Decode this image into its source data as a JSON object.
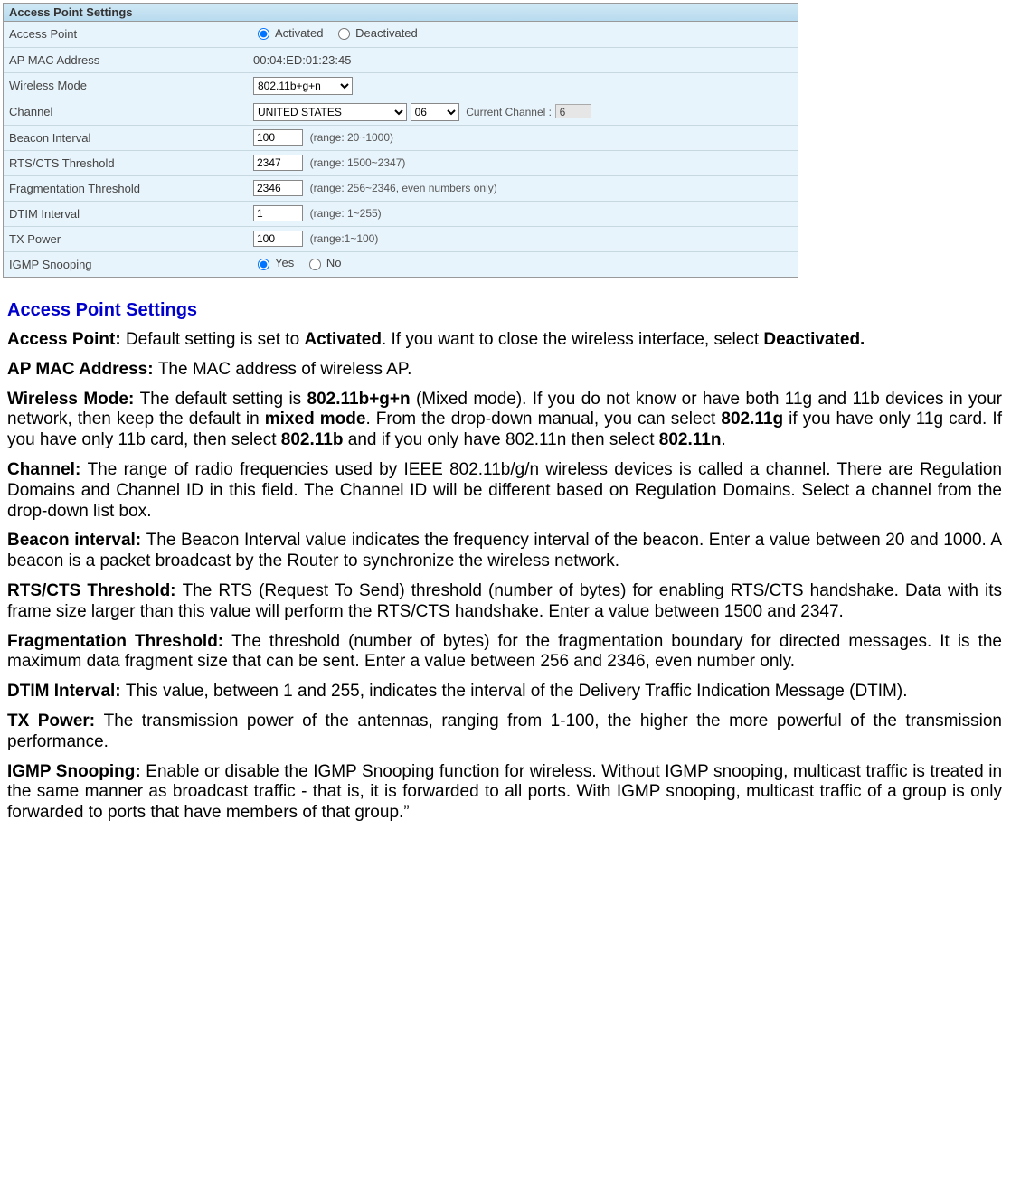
{
  "panel": {
    "title": "Access Point Settings",
    "rows": {
      "access_point": {
        "label": "Access Point",
        "opt_activated": "Activated",
        "opt_deactivated": "Deactivated"
      },
      "mac": {
        "label": "AP MAC Address",
        "value": "00:04:ED:01:23:45"
      },
      "wmode": {
        "label": "Wireless Mode",
        "value": "802.11b+g+n"
      },
      "channel": {
        "label": "Channel",
        "country": "UNITED STATES",
        "ch": "06",
        "current_label": "Current Channel :",
        "current_value": "6"
      },
      "beacon": {
        "label": "Beacon Interval",
        "value": "100",
        "hint": "(range: 20~1000)"
      },
      "rts": {
        "label": "RTS/CTS Threshold",
        "value": "2347",
        "hint": "(range: 1500~2347)"
      },
      "frag": {
        "label": "Fragmentation Threshold",
        "value": "2346",
        "hint": "(range: 256~2346, even numbers only)"
      },
      "dtim": {
        "label": "DTIM Interval",
        "value": "1",
        "hint": "(range: 1~255)"
      },
      "txpower": {
        "label": "TX Power",
        "value": "100",
        "hint": "(range:1~100)"
      },
      "igmp": {
        "label": "IGMP Snooping",
        "opt_yes": "Yes",
        "opt_no": "No"
      }
    }
  },
  "doc": {
    "heading": "Access Point Settings",
    "p_access_point_label": "Access Point: ",
    "p_access_point_1": "Default setting is set to ",
    "p_access_point_bold1": "Activated",
    "p_access_point_2": ". If you want to close the wireless interface, select ",
    "p_access_point_bold2": "Deactivated.",
    "p_mac_label": "AP MAC Address: ",
    "p_mac_text": "The MAC address of wireless AP.",
    "p_wmode_label": "Wireless Mode: ",
    "p_wmode_1": "The default setting is ",
    "p_wmode_bold1": "802.11b+g+n",
    "p_wmode_2": " (Mixed mode). If you do not know or have both 11g and 11b devices in your network, then keep the default in ",
    "p_wmode_bold2": "mixed mode",
    "p_wmode_3": ". From the drop-down manual, you can select ",
    "p_wmode_bold3": "802.11g",
    "p_wmode_4": " if you have only 11g card.  If you have only 11b card, then select ",
    "p_wmode_bold4": "802.11b",
    "p_wmode_5": " and if you only have 802.11n then select ",
    "p_wmode_bold5": "802.11n",
    "p_wmode_6": ".",
    "p_channel_label": "Channel: ",
    "p_channel_text": "The range of radio frequencies used by IEEE 802.11b/g/n wireless devices is called a channel. There are Regulation Domains and Channel ID in this field. The Channel ID will be different based on Regulation Domains. Select a channel from the drop-down list box.",
    "p_beacon_label": "Beacon interval: ",
    "p_beacon_text": "The Beacon Interval value indicates the frequency interval of the beacon. Enter a value between 20 and 1000. A beacon is a packet broadcast by the Router to synchronize the wireless network.",
    "p_rts_label": "RTS/CTS Threshold: ",
    "p_rts_text": "The RTS (Request To Send) threshold (number of bytes) for enabling RTS/CTS handshake. Data with its frame size larger than this value will perform the RTS/CTS handshake. Enter a value between 1500 and 2347.",
    "p_frag_label": "Fragmentation Threshold: ",
    "p_frag_text": "The threshold (number of bytes) for the fragmentation boundary for directed messages. It is the maximum data fragment size that can be sent. Enter a value between 256 and 2346, even number only.",
    "p_dtim_label": "DTIM Interval: ",
    "p_dtim_text": "This value, between 1 and 255, indicates the interval of the Delivery Traffic Indication Message (DTIM).",
    "p_tx_label": "TX Power: ",
    "p_tx_text": "The transmission power of the antennas, ranging from 1-100, the higher the more powerful of the transmission performance.",
    "p_igmp_label": "IGMP Snooping: ",
    "p_igmp_text": "Enable or disable the IGMP Snooping function for wireless. Without IGMP snooping, multicast traffic is treated in the same manner as broadcast traffic - that is, it is forwarded to all ports. With IGMP snooping, multicast traffic of a group is only forwarded to ports that have members of that group.”"
  }
}
